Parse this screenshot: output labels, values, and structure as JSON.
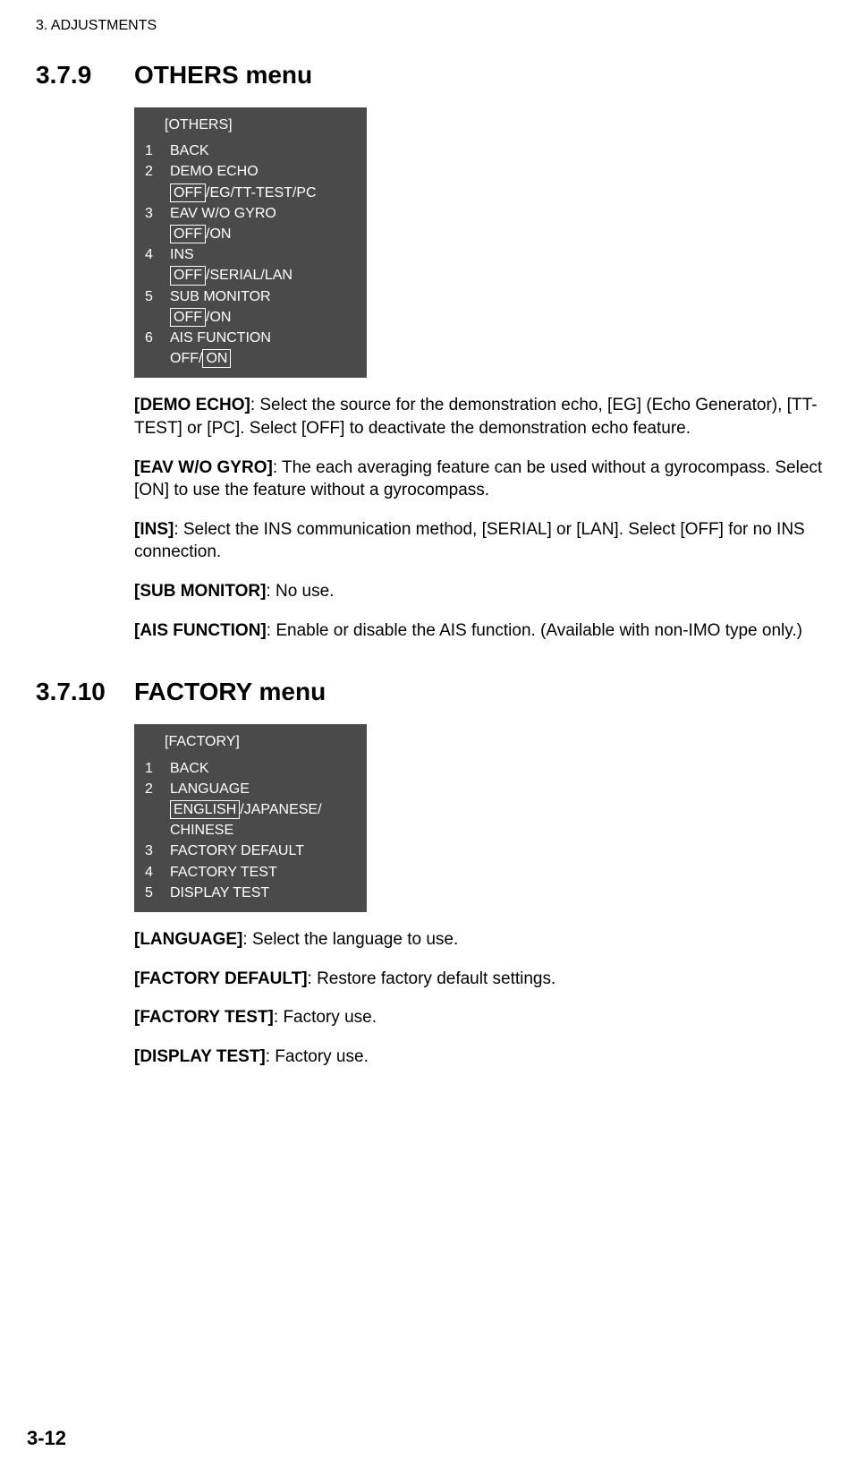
{
  "header": "3.  ADJUSTMENTS",
  "section1": {
    "num": "3.7.9",
    "name": "OTHERS menu"
  },
  "menu1": {
    "title": "[OTHERS]",
    "items": [
      {
        "idx": "1",
        "label": "BACK"
      },
      {
        "idx": "2",
        "label": "DEMO ECHO",
        "opt_boxed": "OFF",
        "opt_rest": "/EG/TT-TEST/PC"
      },
      {
        "idx": "3",
        "label": "EAV W/O GYRO",
        "opt_boxed": "OFF",
        "opt_rest": "/ON"
      },
      {
        "idx": "4",
        "label": "INS",
        "opt_boxed": "OFF",
        "opt_rest": "/SERIAL/LAN"
      },
      {
        "idx": "5",
        "label": "SUB MONITOR",
        "opt_boxed": "OFF",
        "opt_rest": "/ON"
      },
      {
        "idx": "6",
        "label": "AIS FUNCTION",
        "opt_pre": "OFF/",
        "opt_boxed": "ON"
      }
    ]
  },
  "paras1": {
    "demo_b": "[DEMO ECHO]",
    "demo_t": ": Select the source for the demonstration echo, [EG] (Echo Generator), [TT-TEST] or [PC]. Select [OFF] to deactivate the demonstration echo feature.",
    "eav_b": "[EAV W/O GYRO]",
    "eav_t": ": The each averaging feature can be used without a gyrocompass. Select [ON] to use the feature without a gyrocompass.",
    "ins_b": "[INS]",
    "ins_t": ": Select the INS communication method, [SERIAL] or [LAN]. Select [OFF] for no INS connection.",
    "sub_b": "[SUB MONITOR]",
    "sub_t": ": No use.",
    "ais_b": "[AIS FUNCTION]",
    "ais_t": ": Enable or disable the AIS function. (Available with non-IMO type only.)"
  },
  "section2": {
    "num": "3.7.10",
    "name": "FACTORY menu"
  },
  "menu2": {
    "title": "[FACTORY]",
    "items": [
      {
        "idx": "1",
        "label": "BACK"
      },
      {
        "idx": "2",
        "label": "LANGUAGE",
        "opt_boxed": "ENGLISH",
        "opt_rest": "/JAPANESE/",
        "opt_line2": "CHINESE"
      },
      {
        "idx": "3",
        "label": "FACTORY DEFAULT"
      },
      {
        "idx": "4",
        "label": "FACTORY TEST"
      },
      {
        "idx": "5",
        "label": "DISPLAY TEST"
      }
    ]
  },
  "paras2": {
    "lang_b": "[LANGUAGE]",
    "lang_t": ": Select the language to use.",
    "fd_b": "[FACTORY DEFAULT]",
    "fd_t": ": Restore factory default settings.",
    "ft_b": "[FACTORY TEST]",
    "ft_t": ": Factory use.",
    "dt_b": "[DISPLAY TEST]",
    "dt_t": ": Factory use."
  },
  "page_num": "3-12"
}
